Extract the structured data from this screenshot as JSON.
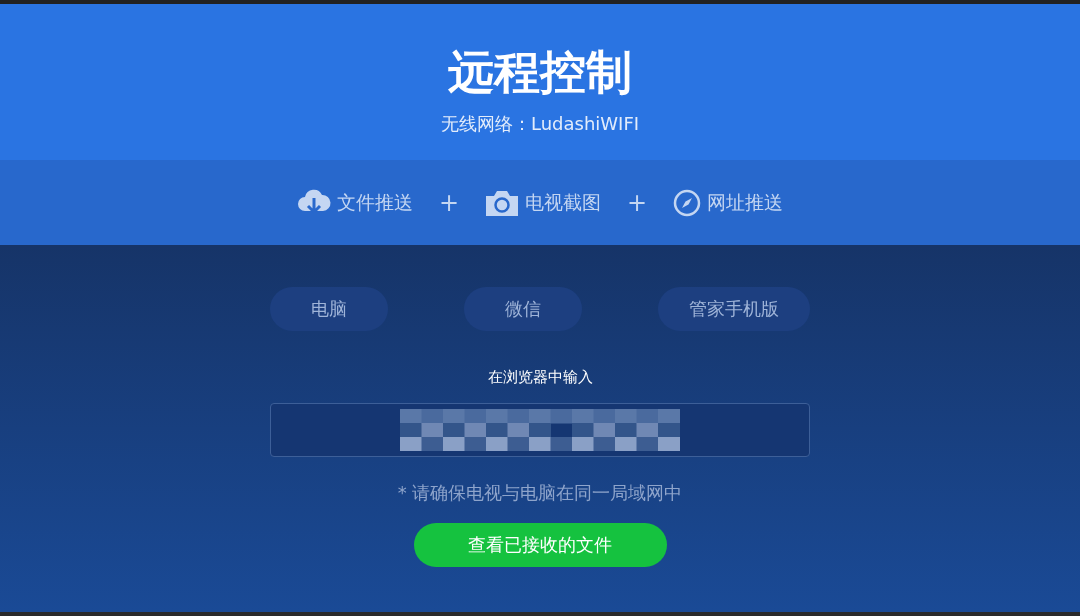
{
  "header": {
    "title": "远程控制",
    "subtitle": "无线网络：LudashiWIFI"
  },
  "features": [
    {
      "kind": "cloud",
      "label": "文件推送"
    },
    {
      "kind": "plus",
      "label": "+"
    },
    {
      "kind": "camera",
      "label": "电视截图"
    },
    {
      "kind": "plus",
      "label": "+"
    },
    {
      "kind": "compass",
      "label": "网址推送"
    }
  ],
  "targets": [
    "电脑",
    "微信",
    "管家手机版"
  ],
  "address": {
    "label": "在浏览器中输入"
  },
  "note": "* 请确保电视与电脑在同一局域网中",
  "button": "查看已接收的文件"
}
